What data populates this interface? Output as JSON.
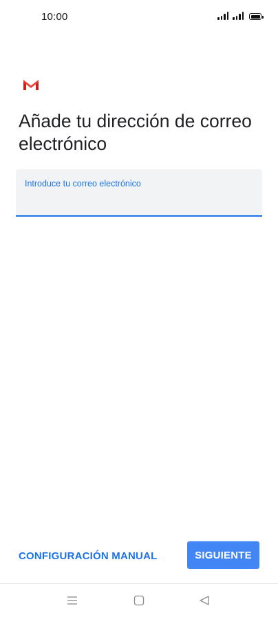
{
  "status_bar": {
    "time": "10:00",
    "icons": [
      "signal-icon",
      "signal-icon",
      "battery-icon"
    ]
  },
  "app": {
    "logo": "gmail-logo",
    "colors": {
      "accent": "#1a73e8",
      "button": "#4285f4",
      "logo_red": "#d93025"
    }
  },
  "main": {
    "title": "Añade tu dirección de correo electrónico",
    "email_field": {
      "label": "Introduce tu correo electrónico",
      "value": ""
    }
  },
  "actions": {
    "manual_label": "CONFIGURACIÓN MANUAL",
    "next_label": "SIGUIENTE"
  },
  "nav_bar": {
    "icons": [
      "menu-icon",
      "home-icon",
      "back-icon"
    ]
  }
}
